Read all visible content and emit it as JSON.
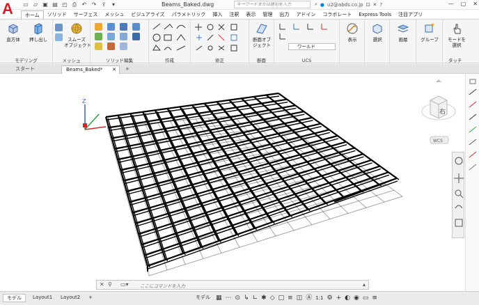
{
  "app": {
    "logo_letter": "A",
    "document_title": "Beams_Baked.dwg",
    "search_placeholder": "キーワードまたは語句を入力",
    "user": "u2@abds.co.jp",
    "accent": "#0a84d6"
  },
  "ribbon_tabs": [
    "ホーム",
    "ソリッド",
    "サーフェス",
    "メッシュ",
    "ビジュアライズ",
    "パラメトリック",
    "挿入",
    "注釈",
    "表示",
    "管理",
    "出力",
    "アドイン",
    "コラボレート",
    "Express Tools",
    "注目アプリ"
  ],
  "ribbon": {
    "modeling": {
      "title": "モデリング",
      "box_label": "直方体",
      "extrude_label": "押し出し"
    },
    "mesh": {
      "title": "メッシュ",
      "smooth_label": "スムーズ\nオブジェクト"
    },
    "solid_edit": {
      "title": "ソリッド編集"
    },
    "draw": {
      "title": "作成"
    },
    "modify": {
      "title": "修正"
    },
    "section": {
      "title": "断面",
      "section_plane_label": "断面オブ\nジェクト"
    },
    "ucs": {
      "title": "UCS",
      "combo_value": "ワールド"
    },
    "view": {
      "label": "表示"
    },
    "select": {
      "label": "選択"
    },
    "layers": {
      "label": "画層"
    },
    "groups": {
      "label": "グループ"
    },
    "touch": {
      "title": "タッチ",
      "label": "モードを\n選択"
    }
  },
  "file_tabs": [
    "スタート",
    "Beams_Baked*"
  ],
  "viewcube": {
    "face_label": "右",
    "ucs_label": "WCS"
  },
  "ucs_icon": {
    "z_label": "Z"
  },
  "command_line": {
    "placeholder": "ここにコマンドを入力"
  },
  "status": {
    "layout_tabs": [
      "モデル",
      "Layout1",
      "Layout2"
    ],
    "model_label": "モデル",
    "scale_label": "1:1"
  }
}
